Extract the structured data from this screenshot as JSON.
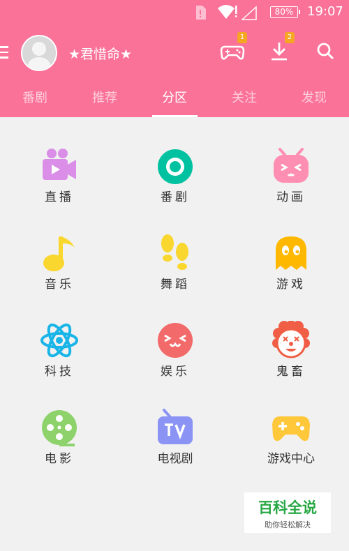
{
  "status_bar": {
    "battery": "80%",
    "time": "19:07"
  },
  "toolbar": {
    "username": "★君惜命★",
    "game_badge": "1",
    "download_badge": "2"
  },
  "tabs": [
    {
      "label": "番剧",
      "active": false
    },
    {
      "label": "推荐",
      "active": false
    },
    {
      "label": "分区",
      "active": true
    },
    {
      "label": "关注",
      "active": false
    },
    {
      "label": "发现",
      "active": false
    }
  ],
  "categories": [
    {
      "label": "直播",
      "icon": "camera-icon",
      "color": "#da8ee7"
    },
    {
      "label": "番剧",
      "icon": "bangumi-icon",
      "color": "#00c2a0"
    },
    {
      "label": "动画",
      "icon": "tv-face-icon",
      "color": "#ff8eb3"
    },
    {
      "label": "音乐",
      "icon": "music-note-icon",
      "color": "#f9d72e"
    },
    {
      "label": "舞蹈",
      "icon": "footprints-icon",
      "color": "#f9d72e"
    },
    {
      "label": "游戏",
      "icon": "ghost-icon",
      "color": "#ffb800"
    },
    {
      "label": "科技",
      "icon": "atom-icon",
      "color": "#19b5e8"
    },
    {
      "label": "娱乐",
      "icon": "smiley-icon",
      "color": "#f36a6a"
    },
    {
      "label": "鬼畜",
      "icon": "clown-icon",
      "color": "#ef5e45"
    },
    {
      "label": "电影",
      "icon": "film-reel-icon",
      "color": "#8ed26b"
    },
    {
      "label": "电视剧",
      "icon": "tv-icon",
      "color": "#8b94f5"
    },
    {
      "label": "游戏中心",
      "icon": "gamepad-icon",
      "color": "#ffc73a"
    }
  ],
  "watermark": {
    "title": "百科全说",
    "subtitle": "助你轻松解决"
  },
  "colors": {
    "brand_pink": "#fb7299",
    "badge_orange": "#f5a623",
    "background": "#f1f1f1"
  }
}
